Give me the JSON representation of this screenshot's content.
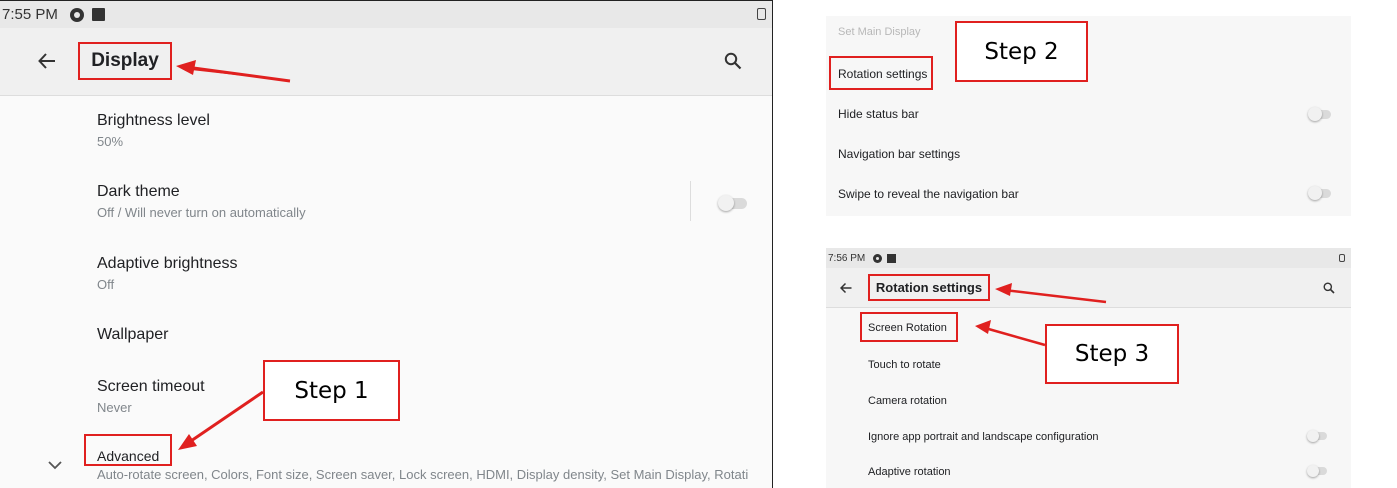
{
  "left_screen": {
    "status_time": "7:55 PM",
    "title": "Display",
    "settings": [
      {
        "title": "Brightness level",
        "subtitle": "50%"
      },
      {
        "title": "Dark theme",
        "subtitle": "Off / Will never turn on automatically",
        "toggle": "off"
      },
      {
        "title": "Adaptive brightness",
        "subtitle": "Off"
      },
      {
        "title": "Wallpaper",
        "subtitle": ""
      },
      {
        "title": "Screen timeout",
        "subtitle": "Never"
      },
      {
        "title": "Advanced",
        "subtitle": "Auto-rotate screen, Colors, Font size, Screen saver, Lock screen, HDMI, Display density, Set Main Display, Rotati"
      }
    ]
  },
  "top_right_screen": {
    "items": [
      {
        "label": "Set Main Display",
        "faded": true
      },
      {
        "label": "Rotation settings"
      },
      {
        "label": "Hide status bar",
        "toggle": "off"
      },
      {
        "label": "Navigation bar settings"
      },
      {
        "label": "Swipe to reveal the navigation bar",
        "toggle": "off"
      }
    ]
  },
  "bottom_right_screen": {
    "status_time": "7:56 PM",
    "title": "Rotation settings",
    "items": [
      {
        "label": "Screen Rotation"
      },
      {
        "label": "Touch to rotate"
      },
      {
        "label": "Camera rotation"
      },
      {
        "label": "Ignore app portrait and landscape configuration",
        "toggle": "off"
      },
      {
        "label": "Adaptive rotation",
        "toggle": "off"
      }
    ]
  },
  "annotations": {
    "step1": "Step 1",
    "step2": "Step 2",
    "step3": "Step 3",
    "highlight_color": "#e0201f"
  },
  "icons": [
    "back-arrow-icon",
    "search-icon",
    "chevron-down-icon",
    "toggle-switch-icon",
    "sim-card-icon",
    "status-dot-icon"
  ]
}
